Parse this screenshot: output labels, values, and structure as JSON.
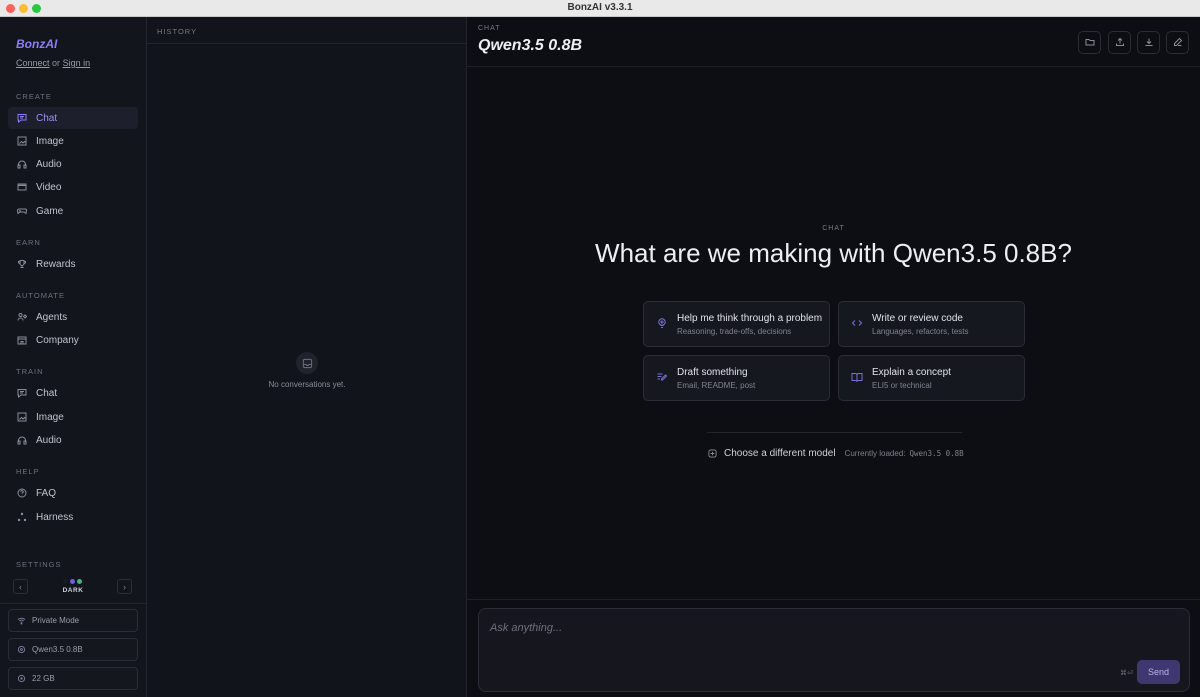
{
  "window": {
    "title": "BonzAI v3.3.1"
  },
  "sidebar": {
    "brand": "BonzAI",
    "connect_link": "Connect",
    "connect_or": "or",
    "signin_link": "Sign in",
    "sections": {
      "create": "CREATE",
      "earn": "EARN",
      "automate": "AUTOMATE",
      "train": "TRAIN",
      "help": "HELP",
      "settings": "SETTINGS"
    },
    "create_items": [
      "Chat",
      "Image",
      "Audio",
      "Video",
      "Game"
    ],
    "earn_items": [
      "Rewards"
    ],
    "automate_items": [
      "Agents",
      "Company"
    ],
    "train_items": [
      "Chat",
      "Image",
      "Audio"
    ],
    "help_items": [
      "FAQ",
      "Harness"
    ],
    "theme": {
      "label": "DARK",
      "dots": [
        "#1a1b22",
        "#6d5fe0",
        "#3bb97c"
      ]
    },
    "footer": {
      "private_mode": "Private Mode",
      "model": "Qwen3.5 0.8B",
      "storage": "22 GB"
    }
  },
  "history": {
    "title": "HISTORY",
    "empty": "No conversations yet."
  },
  "main": {
    "kicker": "CHAT",
    "title": "Qwen3.5 0.8B",
    "hero_kicker": "CHAT",
    "hero_title": "What are we making with Qwen3.5 0.8B?",
    "cards": [
      {
        "title": "Help me think through a problem",
        "subtitle": "Reasoning, trade-offs, decisions",
        "icon": "bulb-icon"
      },
      {
        "title": "Write or review code",
        "subtitle": "Languages, refactors, tests",
        "icon": "code-icon"
      },
      {
        "title": "Draft something",
        "subtitle": "Email, README, post",
        "icon": "pen-icon"
      },
      {
        "title": "Explain a concept",
        "subtitle": "ELI5 or technical",
        "icon": "book-icon"
      }
    ],
    "choose_model": "Choose a different model",
    "currently_loaded_label": "Currently loaded:",
    "currently_loaded_value": "Qwen3.5 0.8B",
    "composer": {
      "placeholder": "Ask anything...",
      "shortcut": "⌘⏎",
      "send": "Send"
    }
  },
  "colors": {
    "accent": "#8c7ff5",
    "background": "#0d0e13",
    "sidebar": "#13151d",
    "send_button": "#3f3870"
  }
}
